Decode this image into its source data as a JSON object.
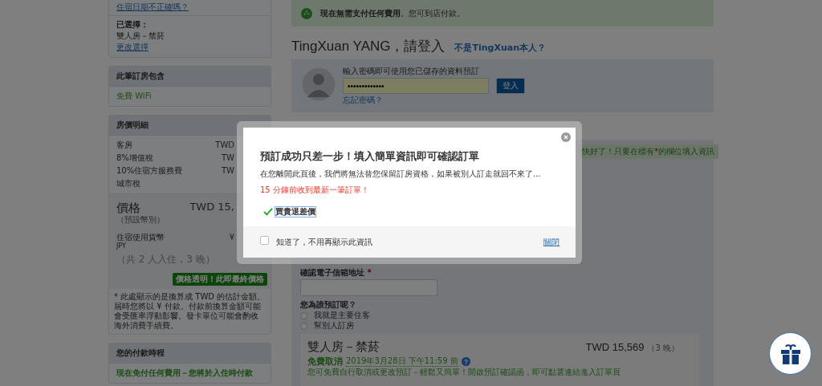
{
  "left_panel": {
    "stay": {
      "date_link": "住宿日期不正確嗎？",
      "selected_label": "已選擇：",
      "selected_room": "雙人房－禁菸",
      "change_link": "更改選擇"
    },
    "includes": {
      "title": "此筆訂房包含",
      "items": [
        "免費 WiFi"
      ]
    },
    "price_details": {
      "title": "房價明細",
      "rows": [
        {
          "label": "客房",
          "amount": "TWD"
        },
        {
          "label": "8%增值稅",
          "amount": "TW"
        },
        {
          "label": "10%住宿方服務費",
          "amount": "TW"
        },
        {
          "label": "城市稅"
        }
      ],
      "price_label": "價格",
      "price_sub": "（預設幣別）",
      "price_amount": "TWD 15,",
      "currency_label": "住宿使用貨幣",
      "currency_code": "JPY",
      "currency_amount": "¥",
      "occupancy": "（共 2 人入住，3 晚）",
      "badge": "價格透明！此即最終價格",
      "note": "* 此處顯示的是換算成 TWD 的估計金額。屆時您將以 ¥ 付款。付款前換算金額可能會受匯率浮動影響。發卡單位可能會酌收海外消費手續費。"
    },
    "payment": {
      "title": "您的付款時程",
      "text": "現在免付任何費用－您將於入住時付款"
    }
  },
  "main": {
    "banner": "**現在無需支付任何費用**。您可到店付款。",
    "login": {
      "heading": "TingXuan YANG，請登入",
      "not_you_link": "不是TingXuan本人？",
      "prompt": "輸入密碼即可使用您已儲存的資料預訂",
      "password": "•••••••••••••",
      "button": "登入",
      "forgot_link": "忘記密碼？"
    },
    "form": {
      "notice": [
        "快好了！只要在標有",
        "*",
        "的欄位填入資訊"
      ],
      "email_confirm_label": "確認電子信箱地址",
      "required_mark": "*",
      "booking_for": {
        "question": "您為誰預訂呢？",
        "options": [
          {
            "label": "我就是主要住客",
            "selected": false
          },
          {
            "label": "幫別人訂房",
            "selected": false
          }
        ]
      }
    },
    "room": {
      "name": "雙人房－禁菸",
      "price": "TWD 15,569",
      "nights": "（3 晚）",
      "free_cancel": "免費取消",
      "deadline": "2019年3月28日 下午11:59 前",
      "help_icon": "?",
      "description": "您可免費自行取消或更改預訂－輕鬆又簡單！開啟預訂確認函，即可點選連結進入訂單頁"
    }
  },
  "modal": {
    "title": "預訂成功只差一步！填入簡單資訊即可確認訂單",
    "message": "在您離開此頁後，我們將無法替您保留訂房資格，如果被別人訂走就回不來了...",
    "alert": "15 分鐘前收到最新一筆訂單！",
    "feature": "買貴退差價",
    "dont_show": {
      "label": "知道了，不用再顯示此資訊",
      "checked": false
    },
    "close_link": "關閉"
  }
}
